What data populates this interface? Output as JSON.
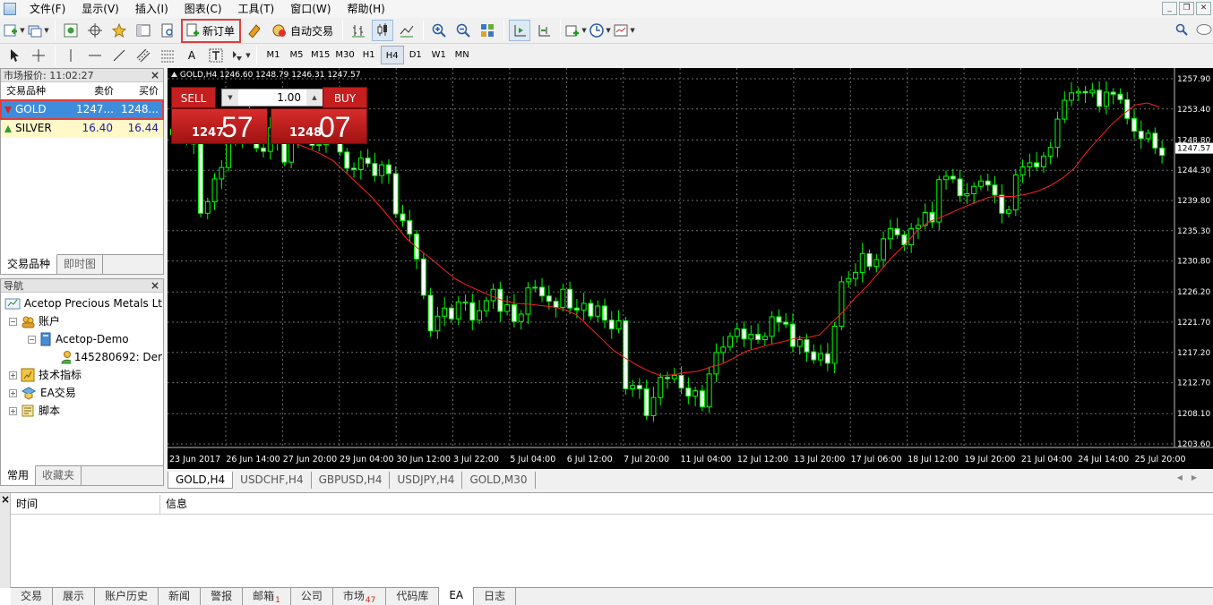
{
  "menu": [
    "文件(F)",
    "显示(V)",
    "插入(I)",
    "图表(C)",
    "工具(T)",
    "窗口(W)",
    "帮助(H)"
  ],
  "toolbar": {
    "new_order": "新订单",
    "auto_trade": "自动交易",
    "timeframes": [
      "M1",
      "M5",
      "M15",
      "M30",
      "H1",
      "H4",
      "D1",
      "W1",
      "MN"
    ],
    "active_timeframe": "H4"
  },
  "market_watch": {
    "title": "市场报价: 11:02:27",
    "headers": [
      "交易品种",
      "卖价",
      "买价"
    ],
    "rows": [
      {
        "symbol": "GOLD",
        "bid": "1247...",
        "ask": "1248..."
      },
      {
        "symbol": "SILVER",
        "bid": "16.40",
        "ask": "16.44"
      }
    ],
    "tabs": [
      "交易品种",
      "即时图"
    ]
  },
  "navigator": {
    "title": "导航",
    "items": {
      "broker": "Acetop Precious Metals Lt",
      "accounts": "账户",
      "account_name": "Acetop-Demo",
      "account_id": "145280692: Der",
      "indicators": "技术指标",
      "experts": "EA交易",
      "scripts": "脚本"
    },
    "tabs": [
      "常用",
      "收藏夹"
    ]
  },
  "chart": {
    "info": "GOLD,H4  1246.60 1248.79 1246.31 1247.57",
    "current_price_label": "1247.57",
    "one_click": {
      "sell": "SELL",
      "buy": "BUY",
      "volume": "1.00",
      "sell_small": "1247",
      "sell_big": "57",
      "buy_small": "1248",
      "buy_big": "07"
    }
  },
  "chart_data": {
    "type": "candlestick",
    "series": [
      {
        "values": [
          1249.6,
          1250.3,
          1249.2,
          1248.2,
          1237.9,
          1239.6,
          1243.0,
          1244.7,
          1250.6,
          1248.8,
          1252.9,
          1249.8,
          1247.6,
          1247.1,
          1250.6,
          1248.7,
          1245.5,
          1248.8,
          1250.9,
          1250.7,
          1248.0,
          1248.1,
          1250.5,
          1250.2,
          1247.0,
          1244.6,
          1244.4,
          1246.1,
          1245.3,
          1243.5,
          1245.1,
          1243.8,
          1237.8,
          1236.8,
          1234.8,
          1231.1,
          1225.7,
          1220.4,
          1222.6,
          1223.8,
          1222.2,
          1224.7,
          1224.6,
          1222.0,
          1223.4,
          1224.9,
          1226.6,
          1223.3,
          1224.3,
          1221.8,
          1222.9,
          1226.8,
          1226.9,
          1225.6,
          1224.8,
          1223.9,
          1226.6,
          1223.8,
          1223.5,
          1224.5,
          1222.6,
          1224.1,
          1222.0,
          1220.7,
          1221.9,
          1211.8,
          1212.3,
          1211.8,
          1207.8,
          1210.5,
          1213.5,
          1213.3,
          1213.8,
          1211.9,
          1210.7,
          1211.5,
          1209.1,
          1214.0,
          1217.2,
          1218.0,
          1219.6,
          1220.7,
          1219.2,
          1219.9,
          1219.1,
          1219.6,
          1222.5,
          1221.7,
          1221.4,
          1218.1,
          1219.1,
          1217.3,
          1216.1,
          1217.0,
          1215.6,
          1221.1,
          1227.7,
          1228.2,
          1229.1,
          1231.9,
          1230.0,
          1231.0,
          1234.1,
          1235.6,
          1234.7,
          1233.2,
          1235.6,
          1236.1,
          1238.0,
          1236.6,
          1242.9,
          1243.4,
          1243.0,
          1240.5,
          1240.8,
          1241.9,
          1242.7,
          1242.1,
          1240.6,
          1237.9,
          1238.4,
          1243.6,
          1244.8,
          1245.4,
          1244.8,
          1246.4,
          1247.7,
          1251.9,
          1254.7,
          1255.8,
          1256.0,
          1255.8,
          1256.2,
          1253.8,
          1255.9,
          1255.6,
          1254.8,
          1252.0,
          1250.1,
          1249.0,
          1249.8,
          1247.6,
          1246.5
        ]
      }
    ],
    "ma_values": [
      1248.5,
      1249.6,
      1250.3,
      1250.7,
      1250.6,
      1250.5,
      1250.1,
      1249.7,
      1249.3,
      1249.0,
      1248.2,
      1247.5,
      1246.7,
      1245.7,
      1244.0,
      1242.3,
      1240.6,
      1238.6,
      1236.4,
      1234.2,
      1232.6,
      1231.2,
      1229.7,
      1228.2,
      1227.2,
      1226.4,
      1225.6,
      1224.9,
      1224.5,
      1224.4,
      1224.2,
      1224.0,
      1223.6,
      1222.8,
      1221.1,
      1219.4,
      1217.6,
      1216.4,
      1215.3,
      1214.4,
      1213.7,
      1213.9,
      1214.2,
      1214.4,
      1215.0,
      1215.5,
      1216.4,
      1217.4,
      1217.9,
      1218.4,
      1218.8,
      1219.3,
      1219.4,
      1219.8,
      1221.6,
      1223.3,
      1225.4,
      1227.2,
      1229.3,
      1231.4,
      1233.1,
      1235.2,
      1236.6,
      1237.3,
      1238.1,
      1238.9,
      1239.6,
      1240.3,
      1240.4,
      1240.4,
      1240.7,
      1241.2,
      1242.0,
      1243.1,
      1244.6,
      1247.0,
      1249.0,
      1251.0,
      1252.6,
      1254.0,
      1254.3,
      1253.7
    ],
    "x_ticks": [
      "23 Jun 2017",
      "26 Jun 14:00",
      "27 Jun 20:00",
      "29 Jun 04:00",
      "30 Jun 12:00",
      "3 Jul 22:00",
      "5 Jul 04:00",
      "6 Jul 12:00",
      "7 Jul 20:00",
      "11 Jul 04:00",
      "12 Jul 12:00",
      "13 Jul 20:00",
      "17 Jul 06:00",
      "18 Jul 12:00",
      "19 Jul 20:00",
      "21 Jul 04:00",
      "24 Jul 14:00",
      "25 Jul 20:00"
    ],
    "y_ticks": [
      "1257.90",
      "1253.40",
      "1248.80",
      "1244.30",
      "1239.80",
      "1235.30",
      "1230.80",
      "1226.20",
      "1221.70",
      "1217.20",
      "1212.70",
      "1208.10",
      "1203.60"
    ],
    "ylim": [
      1203.6,
      1257.9
    ],
    "grid": true,
    "colors": {
      "bull": "#00ff00",
      "bear": "#00ff00",
      "ma": "#ff2020",
      "grid": "#6e6e6e",
      "background": "#000000"
    }
  },
  "chart_tabs": [
    "GOLD,H4",
    "USDCHF,H4",
    "GBPUSD,H4",
    "USDJPY,H4",
    "GOLD,M30"
  ],
  "terminal": {
    "headers": [
      "时间",
      "信息"
    ],
    "tabs": [
      {
        "label": "交易"
      },
      {
        "label": "展示"
      },
      {
        "label": "账户历史"
      },
      {
        "label": "新闻"
      },
      {
        "label": "警报"
      },
      {
        "label": "邮箱",
        "badge": "1"
      },
      {
        "label": "公司"
      },
      {
        "label": "市场",
        "badge": "47"
      },
      {
        "label": "代码库"
      },
      {
        "label": "EA"
      },
      {
        "label": "日志"
      }
    ],
    "active_tab": "EA"
  }
}
